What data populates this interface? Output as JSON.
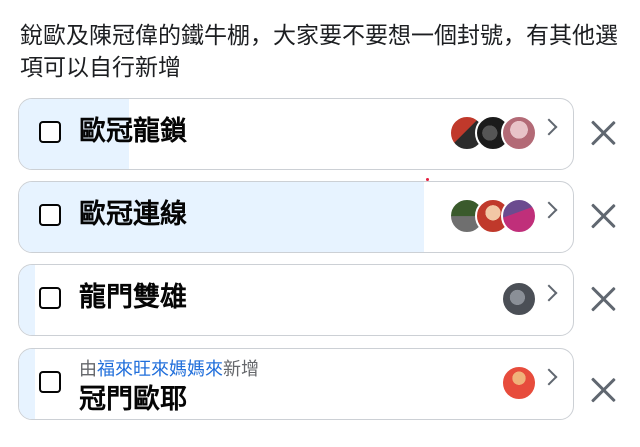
{
  "question": "銳歐及陳冠偉的鐵牛棚，大家要不要想一個封號，有其他選項可以自行新增",
  "options": [
    {
      "label": "歐冠龍鎖",
      "vote_fraction": 0.2,
      "avatars": [
        "avatar-1",
        "avatar-2",
        "avatar-3"
      ]
    },
    {
      "label": "歐冠連線",
      "vote_fraction": 0.73,
      "avatars": [
        "avatar-1",
        "avatar-2",
        "avatar-3"
      ]
    },
    {
      "label": "龍門雙雄",
      "vote_fraction": 0.03,
      "avatars": [
        "avatar-1"
      ]
    },
    {
      "label": "冠門歐耶",
      "vote_fraction": 0.03,
      "added_by_prefix": "由",
      "added_by_name": "福來旺來媽媽來",
      "added_by_suffix": "新增",
      "avatars": [
        "avatar-1"
      ]
    }
  ],
  "colors": {
    "fill": "#e7f3ff",
    "link": "#216fdb",
    "border": "#ccd0d5"
  },
  "icons": {
    "checkbox": "checkbox-icon",
    "chevron": "chevron-right-icon",
    "close": "close-icon"
  }
}
